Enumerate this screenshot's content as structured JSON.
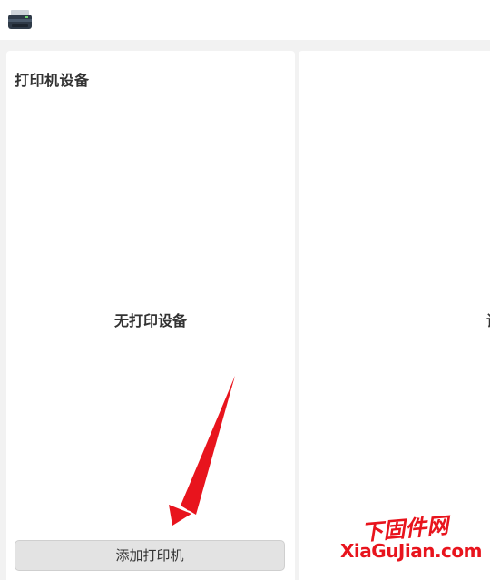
{
  "left_panel": {
    "title": "打印机设备",
    "empty_message": "无打印设备",
    "add_button_label": "添加打印机"
  },
  "right_panel": {
    "cut_text": "请"
  },
  "watermark": {
    "line1": "下固件网",
    "line2": "XiaGuJian.com"
  },
  "colors": {
    "annotation_arrow": "#e8141d",
    "button_bg": "#e3e3e3",
    "panel_bg": "#ffffff",
    "page_bg": "#f2f2f2"
  },
  "icons": {
    "app_icon": "printer-icon"
  }
}
